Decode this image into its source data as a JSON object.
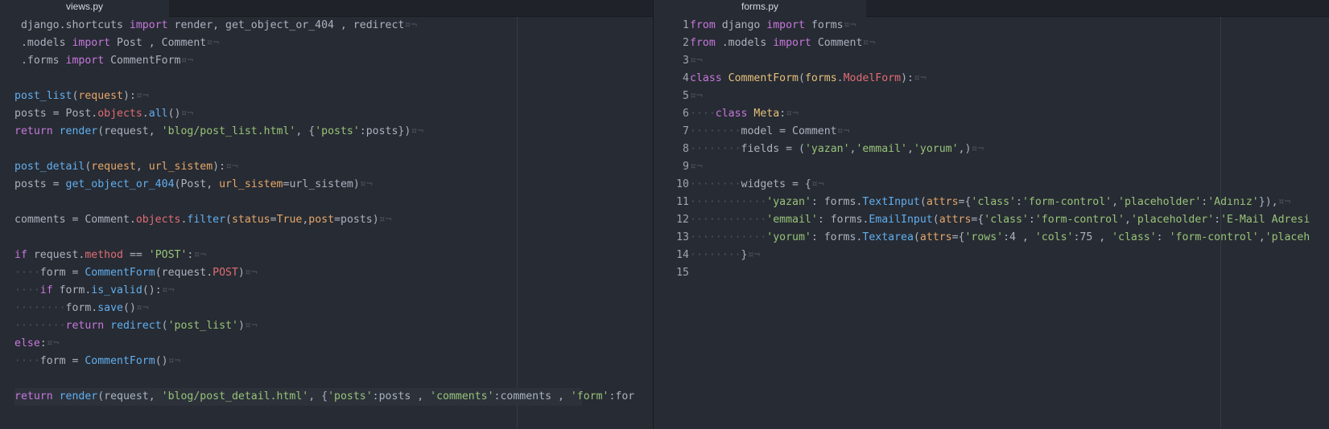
{
  "left_pane": {
    "tab_title": "views.py",
    "lines": [
      [
        [
          "pl",
          " django.shortcuts "
        ],
        [
          "kw",
          "import"
        ],
        [
          "pl",
          " render, get_object_or_404 , redirect"
        ],
        [
          "nl",
          "¤¬"
        ]
      ],
      [
        [
          "pl",
          " .models "
        ],
        [
          "kw",
          "import"
        ],
        [
          "pl",
          " Post , Comment"
        ],
        [
          "nl",
          "¤¬"
        ]
      ],
      [
        [
          "pl",
          " .forms "
        ],
        [
          "kw",
          "import"
        ],
        [
          "pl",
          " CommentForm"
        ],
        [
          "nl",
          "¤¬"
        ]
      ],
      [],
      [
        [
          "fn",
          "post_list"
        ],
        [
          "pl",
          "("
        ],
        [
          "pa",
          "request"
        ],
        [
          "pl",
          "):"
        ],
        [
          "nl",
          "¤¬"
        ]
      ],
      [
        [
          "pl",
          "posts = Post."
        ],
        [
          "at",
          "objects"
        ],
        [
          "pl",
          "."
        ],
        [
          "fn",
          "all"
        ],
        [
          "pl",
          "()"
        ],
        [
          "nl",
          "¤¬"
        ]
      ],
      [
        [
          "kw",
          "return"
        ],
        [
          "pl",
          " "
        ],
        [
          "fn",
          "render"
        ],
        [
          "pl",
          "(request, "
        ],
        [
          "st",
          "'blog/post_list.html'"
        ],
        [
          "pl",
          ", {"
        ],
        [
          "st",
          "'posts'"
        ],
        [
          "pl",
          ":posts})"
        ],
        [
          "nl",
          "¤¬"
        ]
      ],
      [],
      [
        [
          "fn",
          "post_detail"
        ],
        [
          "pl",
          "("
        ],
        [
          "pa",
          "request"
        ],
        [
          "pl",
          ", "
        ],
        [
          "pa",
          "url_sistem"
        ],
        [
          "pl",
          "):"
        ],
        [
          "nl",
          "¤¬"
        ]
      ],
      [
        [
          "pl",
          "posts = "
        ],
        [
          "fn",
          "get_object_or_404"
        ],
        [
          "pl",
          "(Post, "
        ],
        [
          "pa",
          "url_sistem"
        ],
        [
          "pl",
          "=url_sistem)"
        ],
        [
          "nl",
          "¤¬"
        ]
      ],
      [],
      [
        [
          "pl",
          "comments = Comment."
        ],
        [
          "at",
          "objects"
        ],
        [
          "pl",
          "."
        ],
        [
          "fn",
          "filter"
        ],
        [
          "pl",
          "("
        ],
        [
          "pa",
          "status"
        ],
        [
          "pl",
          "="
        ],
        [
          "pa",
          "True"
        ],
        [
          "pl",
          ","
        ],
        [
          "pa",
          "post"
        ],
        [
          "pl",
          "=posts)"
        ],
        [
          "nl",
          "¤¬"
        ]
      ],
      [],
      [
        [
          "kw",
          "if"
        ],
        [
          "pl",
          " request."
        ],
        [
          "at",
          "method"
        ],
        [
          "pl",
          " == "
        ],
        [
          "st",
          "'POST'"
        ],
        [
          "pl",
          ":"
        ],
        [
          "nl",
          "¤¬"
        ]
      ],
      [
        [
          "ws",
          "····"
        ],
        [
          "pl",
          "form = "
        ],
        [
          "fn",
          "CommentForm"
        ],
        [
          "pl",
          "(request."
        ],
        [
          "at",
          "POST"
        ],
        [
          "pl",
          ")"
        ],
        [
          "nl",
          "¤¬"
        ]
      ],
      [
        [
          "ws",
          "····"
        ],
        [
          "kw",
          "if"
        ],
        [
          "pl",
          " form."
        ],
        [
          "fn",
          "is_valid"
        ],
        [
          "pl",
          "():"
        ],
        [
          "nl",
          "¤¬"
        ]
      ],
      [
        [
          "ws",
          "········"
        ],
        [
          "pl",
          "form."
        ],
        [
          "fn",
          "save"
        ],
        [
          "pl",
          "()"
        ],
        [
          "nl",
          "¤¬"
        ]
      ],
      [
        [
          "ws",
          "········"
        ],
        [
          "kw",
          "return"
        ],
        [
          "pl",
          " "
        ],
        [
          "fn",
          "redirect"
        ],
        [
          "pl",
          "("
        ],
        [
          "st",
          "'post_list'"
        ],
        [
          "pl",
          ")"
        ],
        [
          "nl",
          "¤¬"
        ]
      ],
      [
        [
          "kw",
          "else"
        ],
        [
          "pl",
          ":"
        ],
        [
          "nl",
          "¤¬"
        ]
      ],
      [
        [
          "ws",
          "····"
        ],
        [
          "pl",
          "form = "
        ],
        [
          "fn",
          "CommentForm"
        ],
        [
          "pl",
          "()"
        ],
        [
          "nl",
          "¤¬"
        ]
      ],
      [],
      [
        [
          "kw",
          "return"
        ],
        [
          "pl",
          " "
        ],
        [
          "fn",
          "render"
        ],
        [
          "pl",
          "(request, "
        ],
        [
          "st",
          "'blog/post_detail.html'"
        ],
        [
          "pl",
          ", {"
        ],
        [
          "st",
          "'posts'"
        ],
        [
          "pl",
          ":posts , "
        ],
        [
          "st",
          "'comments'"
        ],
        [
          "pl",
          ":comments , "
        ],
        [
          "st",
          "'form'"
        ],
        [
          "pl",
          ":for"
        ]
      ]
    ]
  },
  "right_pane": {
    "tab_title": "forms.py",
    "line_numbers": [
      "1",
      "2",
      "3",
      "4",
      "5",
      "6",
      "7",
      "8",
      "9",
      "10",
      "11",
      "12",
      "13",
      "14",
      "15"
    ],
    "lines": [
      [
        [
          "kw",
          "from"
        ],
        [
          "pl",
          " django "
        ],
        [
          "kw",
          "import"
        ],
        [
          "pl",
          " forms"
        ],
        [
          "nl",
          "¤¬"
        ]
      ],
      [
        [
          "kw",
          "from"
        ],
        [
          "pl",
          " .models "
        ],
        [
          "kw",
          "import"
        ],
        [
          "pl",
          " Comment"
        ],
        [
          "nl",
          "¤¬"
        ]
      ],
      [
        [
          "nl",
          "¤¬"
        ]
      ],
      [
        [
          "kw",
          "class"
        ],
        [
          "pl",
          " "
        ],
        [
          "cl",
          "CommentForm"
        ],
        [
          "pl",
          "("
        ],
        [
          "cl",
          "forms"
        ],
        [
          "pl",
          "."
        ],
        [
          "at",
          "ModelForm"
        ],
        [
          "pl",
          "):"
        ],
        [
          "nl",
          "¤¬"
        ]
      ],
      [
        [
          "nl",
          "¤¬"
        ]
      ],
      [
        [
          "ws",
          "····"
        ],
        [
          "kw",
          "class"
        ],
        [
          "pl",
          " "
        ],
        [
          "cl",
          "Meta"
        ],
        [
          "pl",
          ":"
        ],
        [
          "nl",
          "¤¬"
        ]
      ],
      [
        [
          "ws",
          "········"
        ],
        [
          "pl",
          "model = Comment"
        ],
        [
          "nl",
          "¤¬"
        ]
      ],
      [
        [
          "ws",
          "········"
        ],
        [
          "pl",
          "fields = ("
        ],
        [
          "st",
          "'yazan'"
        ],
        [
          "pl",
          ","
        ],
        [
          "st",
          "'emmail'"
        ],
        [
          "pl",
          ","
        ],
        [
          "st",
          "'yorum'"
        ],
        [
          "pl",
          ",)"
        ],
        [
          "nl",
          "¤¬"
        ]
      ],
      [
        [
          "nl",
          "¤¬"
        ]
      ],
      [
        [
          "ws",
          "········"
        ],
        [
          "pl",
          "widgets = {"
        ],
        [
          "nl",
          "¤¬"
        ]
      ],
      [
        [
          "ws",
          "············"
        ],
        [
          "st",
          "'yazan'"
        ],
        [
          "pl",
          ": forms."
        ],
        [
          "fn",
          "TextInput"
        ],
        [
          "pl",
          "("
        ],
        [
          "pa",
          "attrs"
        ],
        [
          "pl",
          "={"
        ],
        [
          "st",
          "'class'"
        ],
        [
          "pl",
          ":"
        ],
        [
          "st",
          "'form-control'"
        ],
        [
          "pl",
          ","
        ],
        [
          "st",
          "'placeholder'"
        ],
        [
          "pl",
          ":"
        ],
        [
          "st",
          "'Adınız'"
        ],
        [
          "pl",
          "}),"
        ],
        [
          "nl",
          "¤¬"
        ]
      ],
      [
        [
          "ws",
          "············"
        ],
        [
          "st",
          "'emmail'"
        ],
        [
          "pl",
          ": forms."
        ],
        [
          "fn",
          "EmailInput"
        ],
        [
          "pl",
          "("
        ],
        [
          "pa",
          "attrs"
        ],
        [
          "pl",
          "={"
        ],
        [
          "st",
          "'class'"
        ],
        [
          "pl",
          ":"
        ],
        [
          "st",
          "'form-control'"
        ],
        [
          "pl",
          ","
        ],
        [
          "st",
          "'placeholder'"
        ],
        [
          "pl",
          ":"
        ],
        [
          "st",
          "'E-Mail Adresi"
        ]
      ],
      [
        [
          "ws",
          "············"
        ],
        [
          "st",
          "'yorum'"
        ],
        [
          "pl",
          ": forms."
        ],
        [
          "fn",
          "Textarea"
        ],
        [
          "pl",
          "("
        ],
        [
          "pa",
          "attrs"
        ],
        [
          "pl",
          "={"
        ],
        [
          "st",
          "'rows'"
        ],
        [
          "pl",
          ":4 , "
        ],
        [
          "st",
          "'cols'"
        ],
        [
          "pl",
          ":75 , "
        ],
        [
          "st",
          "'class'"
        ],
        [
          "pl",
          ": "
        ],
        [
          "st",
          "'form-control'"
        ],
        [
          "pl",
          ","
        ],
        [
          "st",
          "'placeh"
        ]
      ],
      [
        [
          "ws",
          "········"
        ],
        [
          "pl",
          "}"
        ],
        [
          "nl",
          "¤¬"
        ]
      ],
      []
    ]
  },
  "colors": {
    "keyword": "#c678dd",
    "function": "#61afef",
    "string": "#98c379",
    "param": "#e5a76b",
    "attribute": "#e06c75",
    "class": "#e5c07b",
    "plain": "#abb2bf",
    "invisible": "#4b525e",
    "background": "#272b33"
  }
}
